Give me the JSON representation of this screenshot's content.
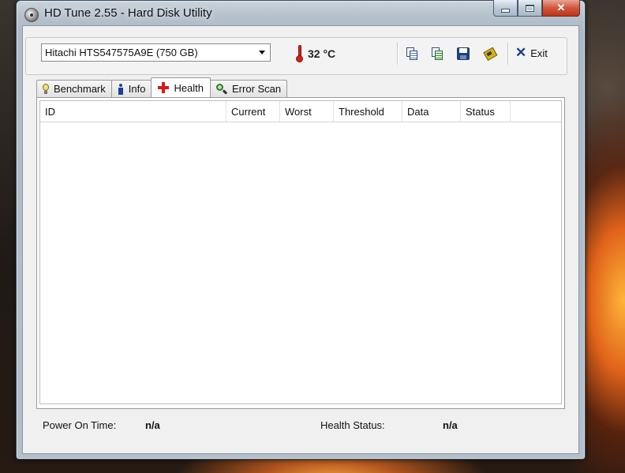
{
  "window": {
    "title": "HD Tune 2.55 - Hard Disk Utility"
  },
  "toolbar": {
    "drive": "Hitachi HTS547575A9E (750 GB)",
    "temperature": "32 °C",
    "icons": [
      "copy-text-icon",
      "copy-info-icon",
      "save-icon",
      "options-icon"
    ],
    "exit_label": "Exit"
  },
  "tabs": [
    {
      "label": "Benchmark",
      "icon": "bulb-icon"
    },
    {
      "label": "Info",
      "icon": "info-icon"
    },
    {
      "label": "Health",
      "icon": "health-cross-icon",
      "active": true
    },
    {
      "label": "Error Scan",
      "icon": "magnifier-icon"
    }
  ],
  "table": {
    "columns": [
      "ID",
      "Current",
      "Worst",
      "Threshold",
      "Data",
      "Status"
    ],
    "rows": []
  },
  "status": {
    "power_on_label": "Power On Time:",
    "power_on_value": "n/a",
    "health_label": "Health Status:",
    "health_value": "n/a"
  }
}
